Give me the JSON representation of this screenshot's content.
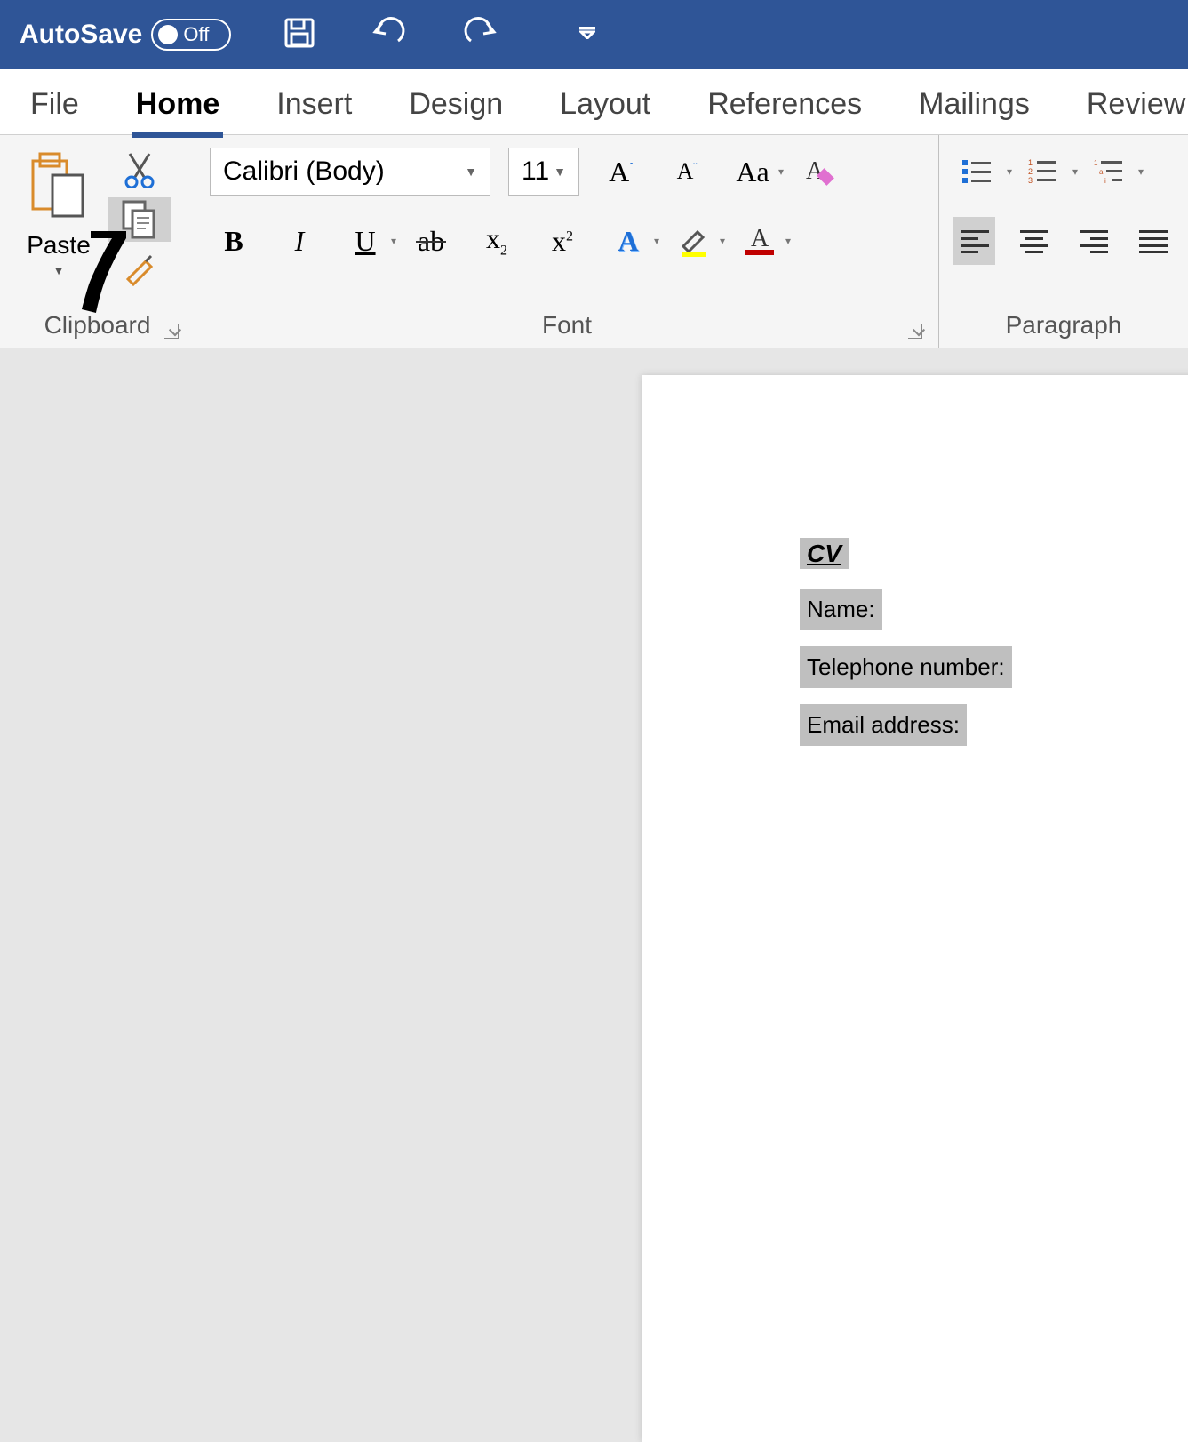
{
  "titlebar": {
    "autosave_label": "AutoSave",
    "toggle_state": "Off"
  },
  "tabs": [
    "File",
    "Home",
    "Insert",
    "Design",
    "Layout",
    "References",
    "Mailings",
    "Review"
  ],
  "active_tab_index": 1,
  "ribbon": {
    "clipboard": {
      "label": "Clipboard",
      "paste_label": "Paste"
    },
    "font": {
      "label": "Font",
      "font_name": "Calibri (Body)",
      "font_size": "11"
    },
    "paragraph": {
      "label": "Paragraph"
    }
  },
  "document": {
    "title_line": "CV",
    "fields": [
      "Name:",
      "Telephone number:",
      "Email address:"
    ]
  },
  "colors": {
    "titlebar_bg": "#2f5597",
    "highlight_yellow": "#ffff00",
    "font_color_red": "#c00000",
    "selection_gray": "#bfbfbf"
  }
}
